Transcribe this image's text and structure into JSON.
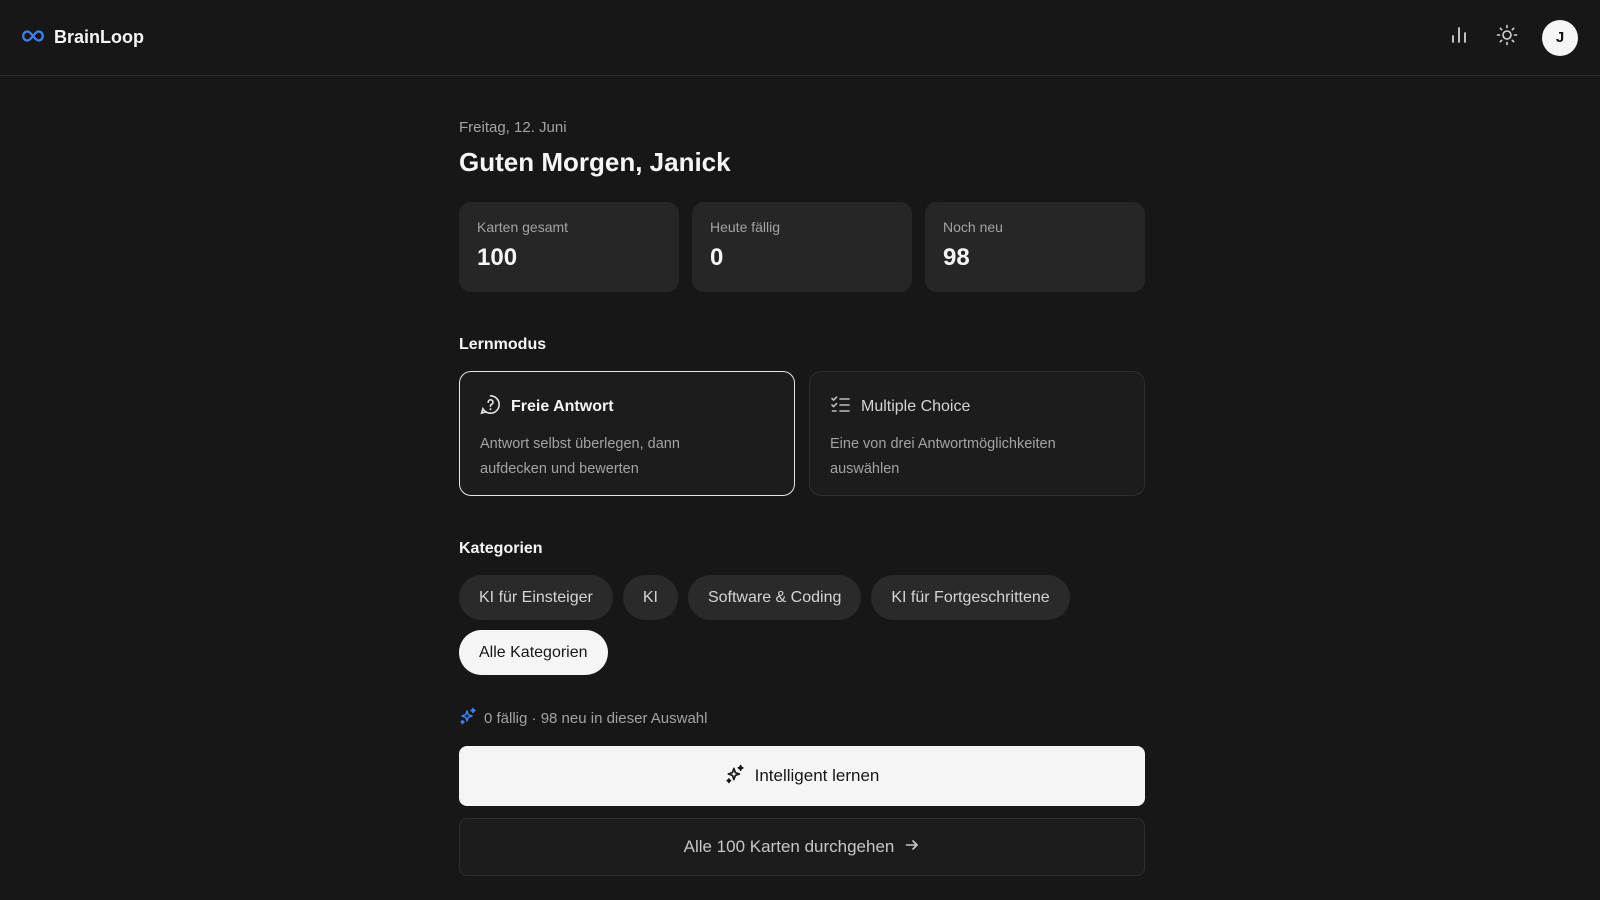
{
  "app": {
    "name": "BrainLoop",
    "logo_icon": "infinity-icon",
    "accent": "#3b82f6"
  },
  "header": {
    "stats_icon": "bar-chart-icon",
    "theme_icon": "sun-icon",
    "avatar_initial": "J"
  },
  "page": {
    "date": "Freitag, 12. Juni",
    "greeting": "Guten Morgen, Janick"
  },
  "stats": [
    {
      "label": "Karten gesamt",
      "value": "100"
    },
    {
      "label": "Heute fällig",
      "value": "0"
    },
    {
      "label": "Noch neu",
      "value": "98"
    }
  ],
  "learn_mode": {
    "title": "Lernmodus",
    "modes": [
      {
        "name": "Freie Antwort",
        "description": "Antwort selbst überlegen, dann aufdecken und bewerten",
        "icon": "question-circle-icon",
        "selected": true
      },
      {
        "name": "Multiple Choice",
        "description": "Eine von drei Antwortmöglichkeiten auswählen",
        "icon": "checklist-icon",
        "selected": false
      }
    ]
  },
  "categories": {
    "title": "Kategorien",
    "items": [
      {
        "label": "KI für Einsteiger",
        "selected": false
      },
      {
        "label": "KI",
        "selected": false
      },
      {
        "label": "Software & Coding",
        "selected": false
      },
      {
        "label": "KI für Fortgeschrittene",
        "selected": false
      },
      {
        "label": "Alle Kategorien",
        "selected": true
      }
    ]
  },
  "summary": {
    "text": "0 fällig · 98 neu in dieser Auswahl",
    "icon": "sparkles-icon"
  },
  "actions": {
    "primary_label": "Intelligent lernen",
    "primary_icon": "sparkles-icon",
    "secondary_label": "Alle 100 Karten durchgehen",
    "secondary_icon": "arrow-right-icon"
  }
}
